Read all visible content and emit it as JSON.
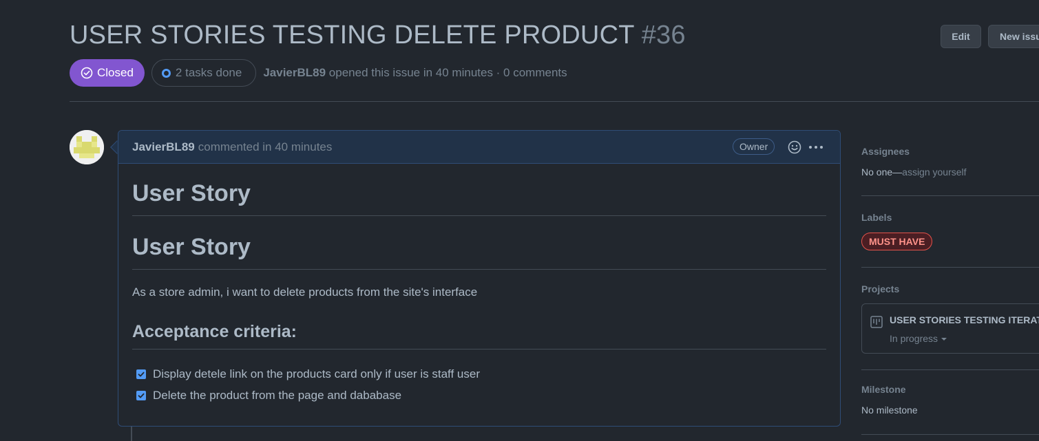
{
  "issue": {
    "title": "USER STORIES TESTING DELETE PRODUCT",
    "number": "#36",
    "state": "Closed",
    "tasks": "2 tasks done",
    "author": "JavierBL89",
    "opened_text": "opened this issue in 40 minutes · 0 comments"
  },
  "header_actions": {
    "edit_label": "Edit",
    "new_issue_label": "New issue"
  },
  "comment": {
    "author": "JavierBL89",
    "when": "commented in 40 minutes",
    "badge": "Owner",
    "heading1": "User Story",
    "heading2": "User Story",
    "paragraph": "As a store admin, i want to delete products from the site's interface",
    "heading3": "Acceptance criteria:",
    "tasks": [
      {
        "label": "Display detele link on the products card only if user is staff user",
        "checked": true
      },
      {
        "label": "Delete the product from the page and dababase",
        "checked": true
      }
    ]
  },
  "sidebar": {
    "assignees": {
      "heading": "Assignees",
      "none": "No one—",
      "action": "assign yourself"
    },
    "labels": {
      "heading": "Labels",
      "items": [
        {
          "name": "MUST HAVE",
          "color": "#e5534b"
        }
      ]
    },
    "projects": {
      "heading": "Projects",
      "name": "USER STORIES TESTING ITERATION",
      "status": "In progress"
    },
    "milestone": {
      "heading": "Milestone",
      "value": "No milestone"
    }
  },
  "colors": {
    "background": "#22272e",
    "closed_badge": "#8256d0",
    "checkbox": "#539bf5",
    "comment_header": "#213248"
  },
  "icons": [
    "closed-circle-icon",
    "progress-ring-icon",
    "smiley-icon",
    "kebab-icon",
    "checkbox-icon",
    "project-board-icon",
    "caret-down-icon"
  ]
}
